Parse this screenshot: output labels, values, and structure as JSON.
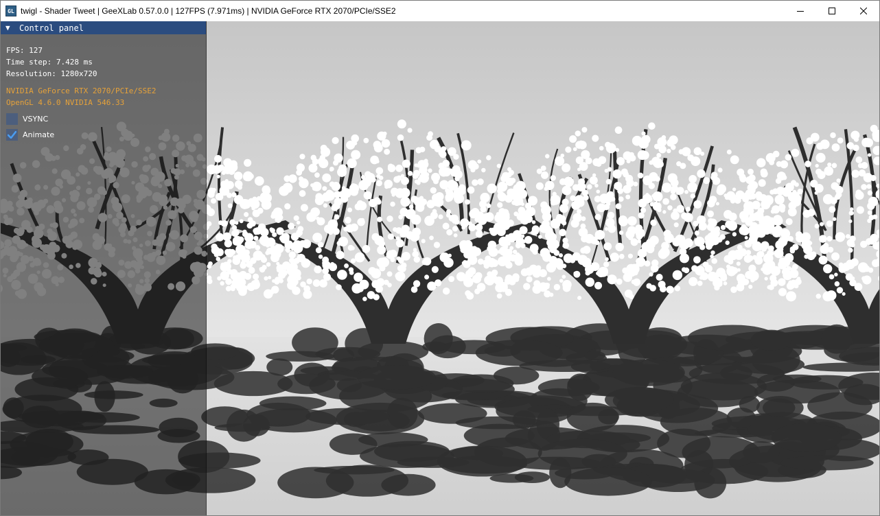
{
  "window": {
    "title": "twigl - Shader Tweet | GeeXLab 0.57.0.0 | 127FPS (7.971ms) | NVIDIA GeForce RTX 2070/PCIe/SSE2",
    "app_icon_text": "GL",
    "controls": [
      "minimize-icon",
      "maximize-icon",
      "close-icon"
    ]
  },
  "panel": {
    "title": "Control panel",
    "fps": "FPS: 127",
    "time_step": "Time step: 7.428 ms",
    "resolution": "Resolution: 1280x720",
    "gpu": "NVIDIA GeForce RTX 2070/PCIe/SSE2",
    "gl_version": "OpenGL 4.6.0 NVIDIA 546.33",
    "checkboxes": [
      {
        "label": "VSYNC",
        "checked": false
      },
      {
        "label": "Animate",
        "checked": true
      }
    ]
  },
  "colors": {
    "panel_header": "#2b4c7f",
    "info_text": "#e6a23a",
    "check_mark": "#4a9cf0"
  },
  "scene": {
    "description_icon": "shader-render",
    "sky_top": "#c8c8c8",
    "sky_bottom": "#e4e4e4",
    "ground": "#d8d8d8",
    "trunk": "#2e2e2e",
    "blossom": "#ffffff"
  }
}
